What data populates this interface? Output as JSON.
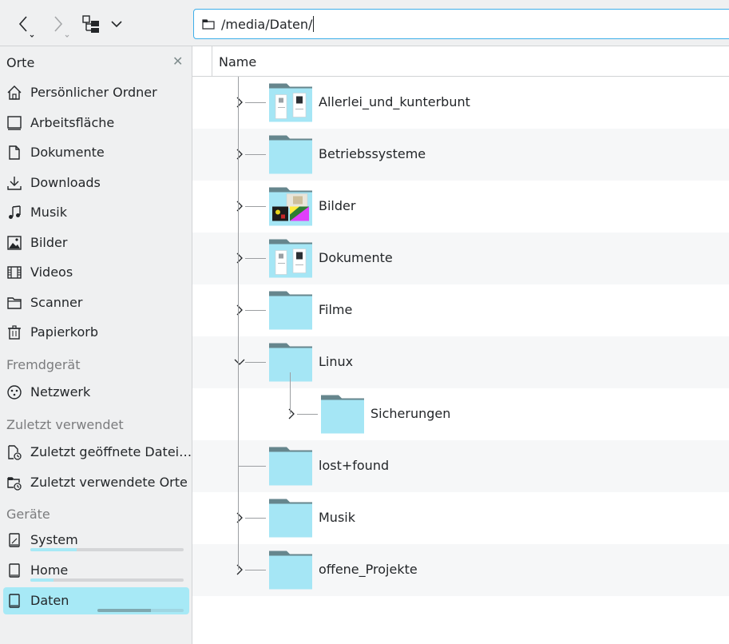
{
  "toolbar": {
    "location_path": "/media/Daten/"
  },
  "sidebar": {
    "header": "Orte",
    "places": [
      {
        "label": "Persönlicher Ordner",
        "icon": "home-icon"
      },
      {
        "label": "Arbeitsfläche",
        "icon": "desktop-icon"
      },
      {
        "label": "Dokumente",
        "icon": "document-icon"
      },
      {
        "label": "Downloads",
        "icon": "download-icon"
      },
      {
        "label": "Musik",
        "icon": "music-icon"
      },
      {
        "label": "Bilder",
        "icon": "image-icon"
      },
      {
        "label": "Videos",
        "icon": "film-icon"
      },
      {
        "label": "Scanner",
        "icon": "folder-icon"
      },
      {
        "label": "Papierkorb",
        "icon": "trash-icon"
      }
    ],
    "remote_header": "Fremdgerät",
    "remote": [
      {
        "label": "Netzwerk",
        "icon": "network-icon"
      }
    ],
    "recent_header": "Zuletzt verwendet",
    "recent": [
      {
        "label": "Zuletzt geöffnete Datei…",
        "icon": "recent-file-icon"
      },
      {
        "label": "Zuletzt verwendete Orte",
        "icon": "recent-folder-icon"
      }
    ],
    "devices_header": "Geräte",
    "devices": [
      {
        "label": "System",
        "icon": "drive-icon",
        "usage": 0.3
      },
      {
        "label": "Home",
        "icon": "drive-icon",
        "usage": 0.15
      },
      {
        "label": "Daten",
        "icon": "drive-icon",
        "usage": 0.62
      }
    ]
  },
  "main": {
    "column_name": "Name",
    "rows": [
      {
        "label": "Allerlei_und_kunterbunt",
        "kind": "docs",
        "state": "collapsed",
        "level": 0
      },
      {
        "label": "Betriebssysteme",
        "kind": "plain",
        "state": "collapsed",
        "level": 0
      },
      {
        "label": "Bilder",
        "kind": "pictures",
        "state": "collapsed",
        "level": 0
      },
      {
        "label": "Dokumente",
        "kind": "docs",
        "state": "collapsed",
        "level": 0
      },
      {
        "label": "Filme",
        "kind": "plain",
        "state": "collapsed",
        "level": 0
      },
      {
        "label": "Linux",
        "kind": "plain",
        "state": "expanded",
        "level": 0
      },
      {
        "label": "Sicherungen",
        "kind": "plain",
        "state": "collapsed",
        "level": 1
      },
      {
        "label": "lost+found",
        "kind": "plain",
        "state": "none",
        "level": 0
      },
      {
        "label": "Musik",
        "kind": "plain",
        "state": "collapsed",
        "level": 0
      },
      {
        "label": "offene_Projekte",
        "kind": "plain",
        "state": "collapsed",
        "level": 0
      }
    ]
  },
  "colors": {
    "accent": "#3daee9",
    "selection": "#a7e9f6",
    "folder_body": "#a5e6f5",
    "folder_tab": "#66868d"
  }
}
